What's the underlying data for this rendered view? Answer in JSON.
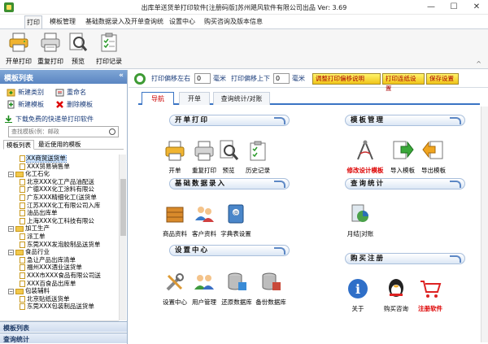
{
  "window": {
    "title": "出库单送货单打印软件[注册码版]苏州飓风软件有限公司出品  Ver: 3.69",
    "minimize": "—",
    "maximize": "☐",
    "close": "✕"
  },
  "menu": {
    "tabs": [
      "打印",
      "模板管理",
      "基础数据录入及开单查询统计",
      "设置中心",
      "购买咨询及版本信息"
    ],
    "active": "打印"
  },
  "ribbon": {
    "buttons": [
      "开单打印",
      "重复打印",
      "预览",
      "打印记录"
    ],
    "collapse": "^"
  },
  "left_panel": {
    "header": "模板列表",
    "header_arrows": "«",
    "actions": {
      "new_category": "新建类别",
      "rename": "重命名",
      "new_template": "新建模板",
      "delete_template": "删除模板"
    },
    "download_link": "下载免费的快递单打印软件",
    "search_placeholder": "查找模板(例：邮政",
    "tabs": [
      "模板列表",
      "最近使用的模板"
    ],
    "tree": [
      {
        "level": 2,
        "type": "doc",
        "label": "XX商贸送货单",
        "selected": true
      },
      {
        "level": 2,
        "type": "doc",
        "label": "XXX贸易销售单"
      },
      {
        "level": 1,
        "type": "folder",
        "label": "化工石化",
        "expander": "−"
      },
      {
        "level": 2,
        "type": "doc",
        "label": "北京XXX化工产品油配送"
      },
      {
        "level": 2,
        "type": "doc",
        "label": "广德XXX化工涂料有限公"
      },
      {
        "level": 2,
        "type": "doc",
        "label": "广东XXX精细化工(送货单"
      },
      {
        "level": 2,
        "type": "doc",
        "label": "江苏XXX化工有限公司入库"
      },
      {
        "level": 2,
        "type": "doc",
        "label": "油品出库单"
      },
      {
        "level": 2,
        "type": "doc",
        "label": "上海XXX化工科技有限公"
      },
      {
        "level": 1,
        "type": "folder",
        "label": "加工生产",
        "expander": "−"
      },
      {
        "level": 2,
        "type": "doc",
        "label": "派工单"
      },
      {
        "level": 2,
        "type": "doc",
        "label": "东莞XXX发泡胶制品送货单"
      },
      {
        "level": 1,
        "type": "folder",
        "label": "食品行业",
        "expander": "−"
      },
      {
        "level": 2,
        "type": "doc",
        "label": "急让产品出库清单"
      },
      {
        "level": 2,
        "type": "doc",
        "label": "福州XXX酒业送货单"
      },
      {
        "level": 2,
        "type": "doc",
        "label": "XXX市XXX食品有限公司送"
      },
      {
        "level": 2,
        "type": "doc",
        "label": "XXX百食品出库单"
      },
      {
        "level": 1,
        "type": "folder",
        "label": "包装辅料",
        "expander": "−"
      },
      {
        "level": 2,
        "type": "doc",
        "label": "北京贴纸送货单"
      },
      {
        "level": 2,
        "type": "doc",
        "label": "东莞XXX包装制品送货单"
      }
    ],
    "bottom_tabs": [
      "模板列表",
      "查询统计"
    ]
  },
  "settings_bar": {
    "offset_lr_label": "打印偏移左右",
    "offset_lr_value": "0",
    "unit1": "毫米",
    "offset_ud_label": "打印偏移上下",
    "offset_ud_value": "0",
    "unit2": "毫米",
    "btn_adjust": "调整打印偏移说明",
    "btn_continuous": "打印连纸设置",
    "btn_save": "保存设置"
  },
  "nav_tabs": [
    "导航",
    "开单",
    "查询统计/对账"
  ],
  "sections": {
    "print": {
      "title": "开单打印",
      "items": [
        "开单",
        "重复打印",
        "预览",
        "历史记录"
      ]
    },
    "template": {
      "title": "模板管理",
      "items": [
        "修改设计模板",
        "导入模板",
        "导出模板"
      ]
    },
    "basic": {
      "title": "基础数据录入",
      "items": [
        "商品资料",
        "客户资料",
        "字典表设置"
      ]
    },
    "query": {
      "title": "查询统计",
      "items": [
        "月结|对账"
      ]
    },
    "settings": {
      "title": "设置中心",
      "items": [
        "设置中心",
        "用户管理",
        "还原数据库",
        "备份数据库"
      ]
    },
    "purchase": {
      "title": "购买注册",
      "items": [
        "关于",
        "购买咨询",
        "注册软件"
      ]
    }
  },
  "colors": {
    "accent_blue": "#3a74c4",
    "header_blue": "#5b86c2",
    "red_label": "#d00000",
    "yellow_btn": "#f0c419"
  }
}
